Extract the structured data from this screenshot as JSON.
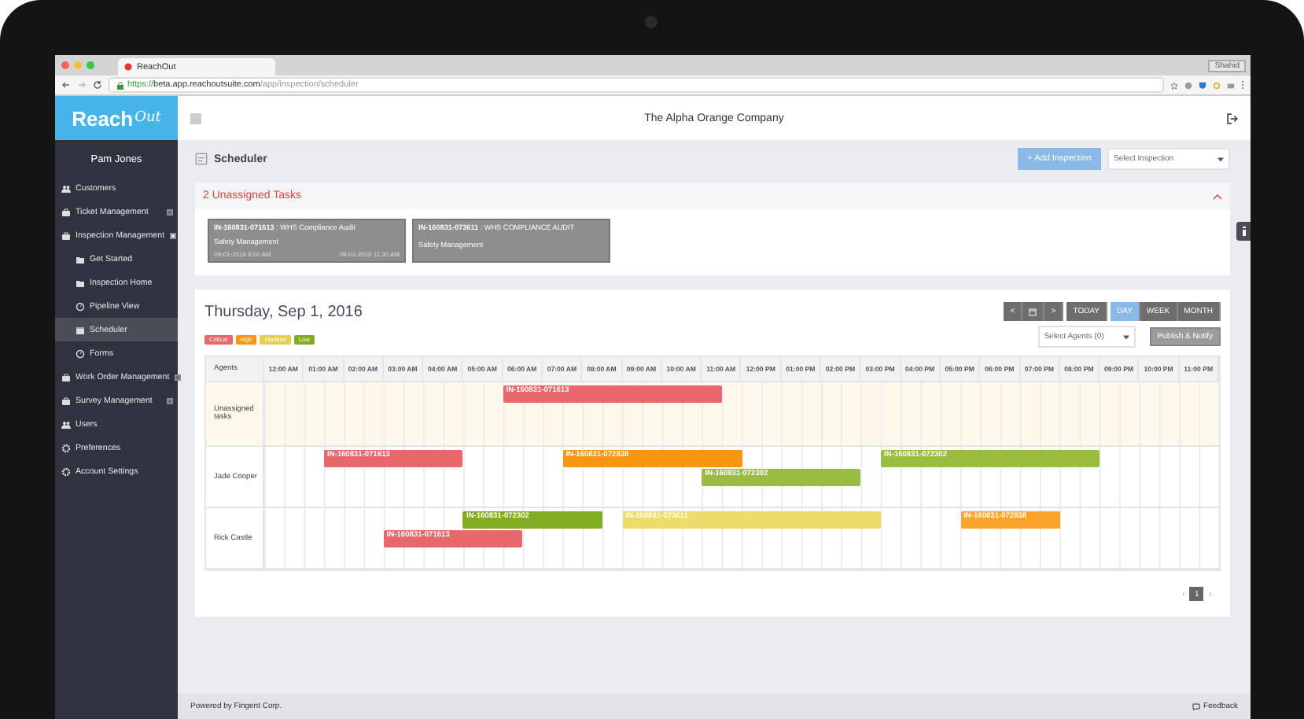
{
  "browser": {
    "tab_title": "ReachOut",
    "url_scheme": "https://",
    "url_host": "beta.app.reachoutsuite.com",
    "url_path": "/app/inspection/scheduler",
    "profile": "Shahid"
  },
  "app": {
    "logo_main": "Reach",
    "logo_script": "Out",
    "company": "The Alpha Orange Company"
  },
  "sidebar": {
    "user": "Pam Jones",
    "items": [
      {
        "label": "Customers",
        "selected": false
      },
      {
        "label": "Ticket Management",
        "selected": false,
        "expanded": false
      },
      {
        "label": "Inspection Management",
        "selected": false,
        "expanded": true,
        "children": [
          {
            "label": "Get Started",
            "selected": false
          },
          {
            "label": "Inspection Home",
            "selected": false
          },
          {
            "label": "Pipeline View",
            "selected": false
          },
          {
            "label": "Scheduler",
            "selected": true
          },
          {
            "label": "Forms",
            "selected": false
          }
        ]
      },
      {
        "label": "Work Order Management",
        "selected": false,
        "expanded": false
      },
      {
        "label": "Survey Management",
        "selected": false,
        "expanded": false
      },
      {
        "label": "Users",
        "selected": false
      },
      {
        "label": "Preferences",
        "selected": false
      },
      {
        "label": "Account Settings",
        "selected": false
      }
    ]
  },
  "page": {
    "title": "Scheduler",
    "add_button": "+ Add Inspection",
    "inspection_select": {
      "placeholder": "Select Inspection"
    }
  },
  "unassigned": {
    "title": "2 Unassigned Tasks",
    "expanded": true,
    "tasks": [
      {
        "title": "**IN-160831-071613** : WHS Compliance Audit",
        "category": "Safety Management",
        "start": "09-01-2016 6:00 AM",
        "end": "09-01-2016 11:30 AM"
      },
      {
        "title": "**IN-160831-073611** : WHS COMPLIANCE AUDIT",
        "category": "Safety Management"
      }
    ]
  },
  "calendar": {
    "date": "Thursday, Sep 1, 2016",
    "prev": "<",
    "next": ">",
    "today": "TODAY",
    "views": [
      {
        "label": "DAY",
        "selected": true
      },
      {
        "label": "WEEK",
        "selected": false
      },
      {
        "label": "MONTH",
        "selected": false
      }
    ],
    "legend": [
      {
        "label": "Critical",
        "color": "#e8676a"
      },
      {
        "label": "High",
        "color": "#f7960f"
      },
      {
        "label": "Medium",
        "color": "#e2d04e"
      },
      {
        "label": "Low",
        "color": "#82ad22"
      }
    ],
    "agents_select": {
      "placeholder": "Select Agents (0)"
    },
    "publish": "Publish & Notify",
    "agents_heading": "Agents",
    "hours": [
      "12:00 AM",
      "01:00 AM",
      "02:00 AM",
      "03:00 AM",
      "04:00 AM",
      "05:00 AM",
      "06:00 AM",
      "07:00 AM",
      "08:00 AM",
      "09:00 AM",
      "10:00 AM",
      "11:00 AM",
      "12:00 PM",
      "01:00 PM",
      "02:00 PM",
      "03:00 PM",
      "04:00 PM",
      "05:00 PM",
      "06:00 PM",
      "07:00 PM",
      "08:00 PM",
      "09:00 PM",
      "10:00 PM",
      "11:00 PM"
    ],
    "rows": [
      {
        "name": "Unassigned tasks",
        "highlighted": true,
        "lanes": [
          [
            {
              "label": "IN-160831-071613",
              "color": "#e8676a"
            }
          ]
        ]
      },
      {
        "name": "Jade Cooper",
        "highlighted": false,
        "lanes": [
          [
            {
              "label": "IN-160831-071613",
              "color": "#e8676a"
            },
            {
              "label": "IN-160831-072838",
              "color": "#f7960f"
            },
            {
              "label": "IN-160831-072302",
              "color": "#98bd40"
            }
          ],
          [
            {
              "label": "IN-160831-072302",
              "color": "#98bd40"
            }
          ]
        ]
      },
      {
        "name": "Rick Castle",
        "highlighted": false,
        "lanes": [
          [
            {
              "label": "IN-160831-072302",
              "color": "#82ad22"
            },
            {
              "label": "IN-160831-073611",
              "color": "#ecdc6c"
            },
            {
              "label": "IN-160831-072838",
              "color": "#f9a52b"
            }
          ],
          [
            {
              "label": "IN-160831-071613",
              "color": "#e8676a"
            }
          ]
        ]
      }
    ],
    "pagination": {
      "prev": "‹",
      "pages": [
        {
          "label": "1",
          "selected": true
        }
      ],
      "next": "›"
    }
  },
  "footer": {
    "credit": "Powered by Fingent Corp.",
    "feedback": "Feedback"
  }
}
